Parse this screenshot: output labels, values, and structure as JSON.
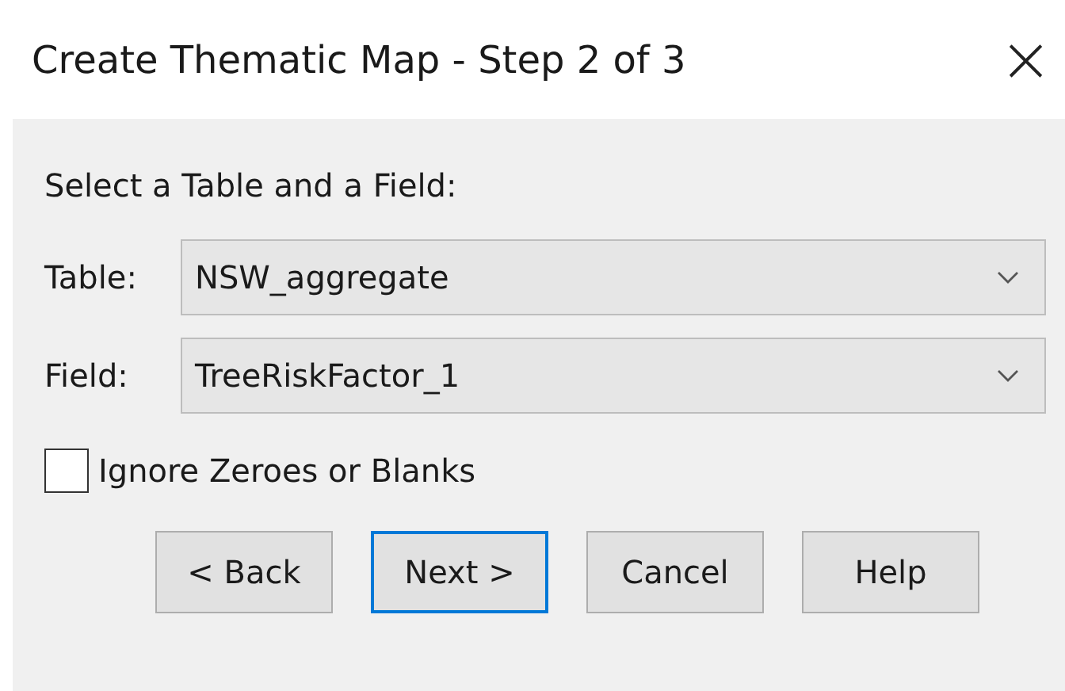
{
  "window": {
    "title": "Create Thematic Map - Step 2 of 3",
    "close": "×"
  },
  "prompt": "Select a Table and a Field:",
  "selectors": [
    {
      "label": "Table:",
      "value": "NSW_aggregate"
    },
    {
      "label": "Field:",
      "value": "TreeRiskFactor_1"
    }
  ],
  "checkbox": {
    "label": "Ignore Zeroes or Blanks",
    "checked": false
  },
  "buttons": [
    {
      "label": "< Back",
      "focused": false
    },
    {
      "label": "Next >",
      "focused": true
    },
    {
      "label": "Cancel",
      "focused": false
    },
    {
      "label": "Help",
      "focused": false
    }
  ]
}
